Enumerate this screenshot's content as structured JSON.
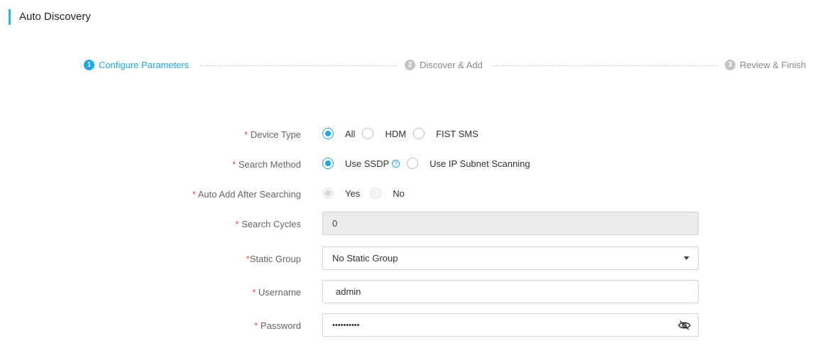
{
  "header": {
    "title": "Auto Discovery"
  },
  "steps": [
    {
      "num": "1",
      "label": "Configure Parameters",
      "state": "active"
    },
    {
      "num": "2",
      "label": "Discover & Add",
      "state": "inactive"
    },
    {
      "num": "3",
      "label": "Review & Finish",
      "state": "inactive"
    }
  ],
  "form": {
    "device_type": {
      "required_mark": "* ",
      "label": "Device Type",
      "options": [
        "All",
        "HDM",
        "FIST SMS"
      ],
      "selected": "All"
    },
    "search_method": {
      "required_mark": "* ",
      "label": "Search Method",
      "options": [
        "Use SSDP",
        "Use IP Subnet Scanning"
      ],
      "selected": "Use SSDP",
      "help_icon": "question-circle-icon",
      "help_glyph": "?"
    },
    "auto_add": {
      "required_mark": "* ",
      "label": "Auto Add After Searching",
      "options": [
        "Yes",
        "No"
      ],
      "selected": "Yes",
      "disabled": true
    },
    "search_cycles": {
      "required_mark": "* ",
      "label": "Search Cycles",
      "value": "0",
      "disabled": true
    },
    "static_group": {
      "required_mark": "*",
      "label": "Static Group",
      "value": "No Static Group"
    },
    "username": {
      "required_mark": "* ",
      "label": "Username",
      "value": "admin"
    },
    "password": {
      "required_mark": "* ",
      "label": "Password",
      "value": "••••••••••",
      "toggle_icon": "eye-slash-icon"
    }
  },
  "colors": {
    "accent": "#1da7e6",
    "title_bar": "#30b3e8",
    "required": "#e04a4a"
  }
}
